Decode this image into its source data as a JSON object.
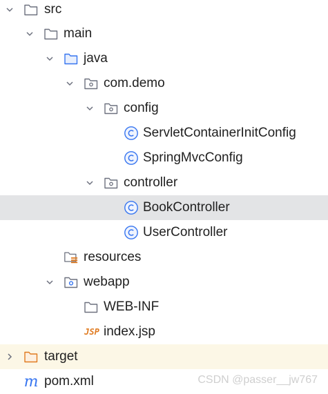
{
  "tree": {
    "src": {
      "label": "src",
      "icon": "folder-icon",
      "state": "expanded"
    },
    "main": {
      "label": "main",
      "icon": "folder-icon",
      "state": "expanded"
    },
    "java": {
      "label": "java",
      "icon": "source-folder-icon",
      "state": "expanded"
    },
    "com_demo": {
      "label": "com.demo",
      "icon": "package-icon",
      "state": "expanded"
    },
    "config": {
      "label": "config",
      "icon": "package-icon",
      "state": "expanded"
    },
    "servlet_container_init_config": {
      "label": "ServletContainerInitConfig",
      "icon": "java-class-icon"
    },
    "spring_mvc_config": {
      "label": "SpringMvcConfig",
      "icon": "java-class-icon"
    },
    "controller": {
      "label": "controller",
      "icon": "package-icon",
      "state": "expanded"
    },
    "book_controller": {
      "label": "BookController",
      "icon": "java-class-icon",
      "selected": true
    },
    "user_controller": {
      "label": "UserController",
      "icon": "java-class-icon"
    },
    "resources": {
      "label": "resources",
      "icon": "resources-folder-icon"
    },
    "webapp": {
      "label": "webapp",
      "icon": "web-folder-icon",
      "state": "expanded"
    },
    "web_inf": {
      "label": "WEB-INF",
      "icon": "folder-icon"
    },
    "index_jsp": {
      "label": "index.jsp",
      "icon": "jsp-file-icon",
      "icon_text": "JSP"
    },
    "target": {
      "label": "target",
      "icon": "excluded-folder-icon",
      "state": "collapsed"
    },
    "pom_xml": {
      "label": "pom.xml",
      "icon": "maven-icon",
      "icon_text": "m"
    }
  },
  "watermark": "CSDN @passer__jw767",
  "colors": {
    "selected_row": "#e3e4e6",
    "excluded_row": "#fcf7e6",
    "class_icon": "#3574f0",
    "source_folder": "#3574f0",
    "excluded_folder": "#e07a1f",
    "jsp": "#e07a1f",
    "maven": "#3574f0"
  }
}
